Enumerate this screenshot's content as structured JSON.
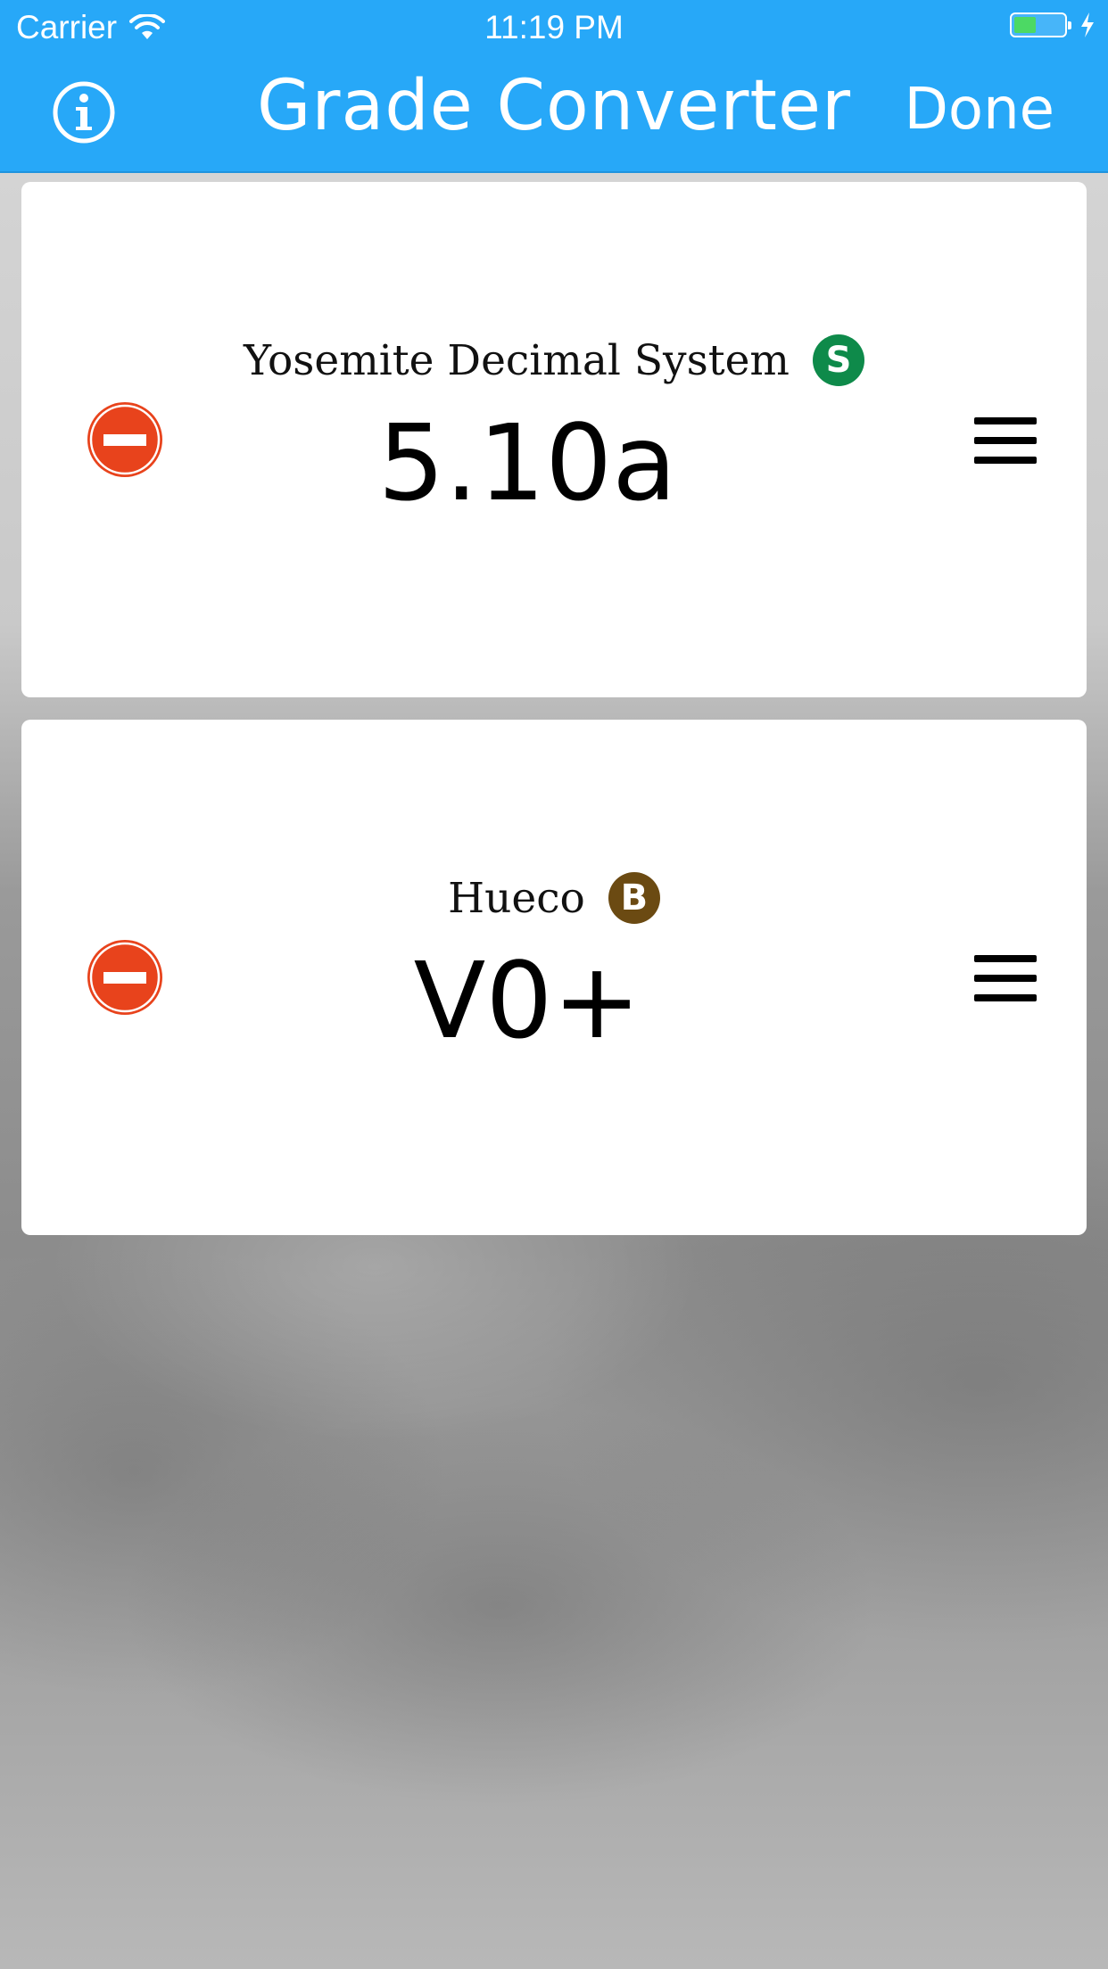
{
  "status_bar": {
    "carrier": "Carrier",
    "time": "11:19 PM",
    "battery_level": 0.45,
    "battery_color": "#4cd964"
  },
  "nav": {
    "title": "Grade Converter",
    "done_label": "Done",
    "info_icon": "info-icon",
    "background_color": "#27a8f8"
  },
  "cards": [
    {
      "system": "Yosemite Decimal System",
      "badge": "S",
      "badge_color": "#0e8a4a",
      "grade": "5.10a"
    },
    {
      "system": "Hueco",
      "badge": "B",
      "badge_color": "#6b4a12",
      "grade": "V0+"
    }
  ],
  "colors": {
    "delete_red": "#e8431c"
  }
}
